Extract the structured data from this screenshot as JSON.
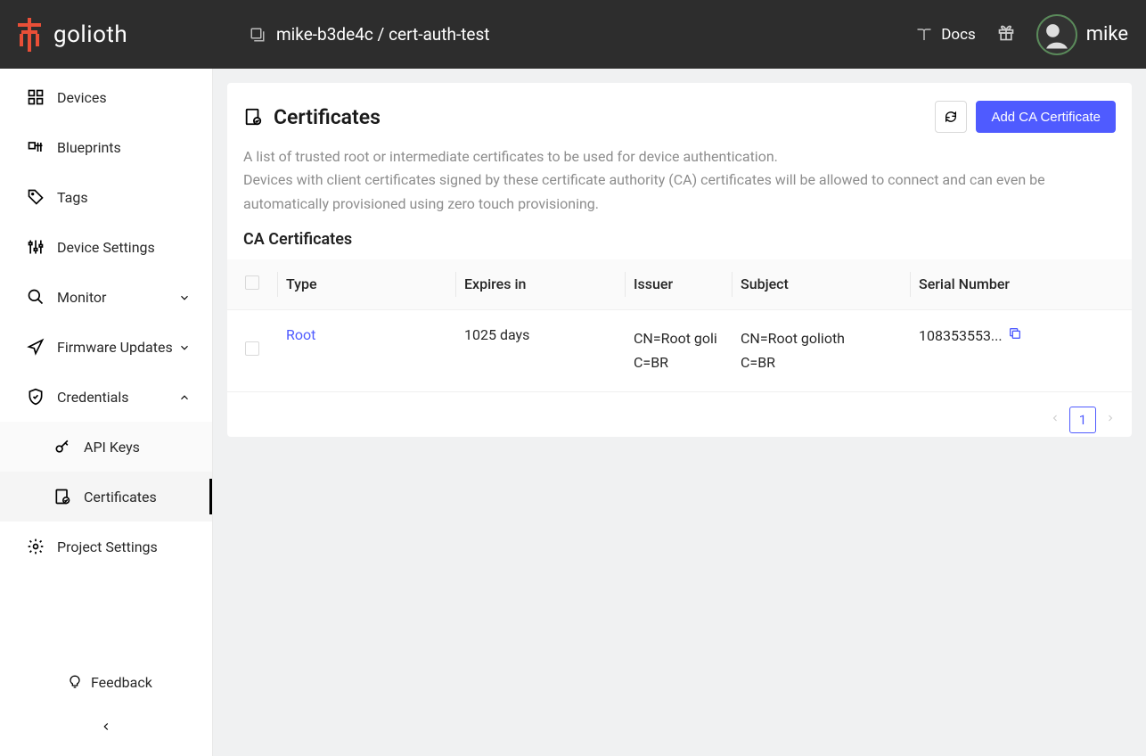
{
  "brand": {
    "name": "golioth"
  },
  "header": {
    "breadcrumb": "mike-b3de4c / cert-auth-test",
    "docs_label": "Docs",
    "username": "mike"
  },
  "sidebar": {
    "items": [
      {
        "label": "Devices",
        "icon": "grid"
      },
      {
        "label": "Blueprints",
        "icon": "blueprint"
      },
      {
        "label": "Tags",
        "icon": "tag"
      },
      {
        "label": "Device Settings",
        "icon": "sliders"
      },
      {
        "label": "Monitor",
        "icon": "search",
        "expandable": true,
        "expanded": false
      },
      {
        "label": "Firmware Updates",
        "icon": "send",
        "expandable": true,
        "expanded": false
      },
      {
        "label": "Credentials",
        "icon": "shield",
        "expandable": true,
        "expanded": true,
        "children": [
          {
            "label": "API Keys",
            "icon": "key",
            "active": false
          },
          {
            "label": "Certificates",
            "icon": "certificate",
            "active": true
          }
        ]
      },
      {
        "label": "Project Settings",
        "icon": "gear"
      }
    ],
    "feedback_label": "Feedback"
  },
  "page": {
    "title": "Certificates",
    "add_button": "Add CA Certificate",
    "description_line1": "A list of trusted root or intermediate certificates to be used for device authentication.",
    "description_line2": "Devices with client certificates signed by these certificate authority (CA) certificates will be allowed to connect and can even be automatically provisioned using zero touch provisioning.",
    "subheading": "CA Certificates"
  },
  "table": {
    "columns": {
      "type": "Type",
      "expires": "Expires in",
      "issuer": "Issuer",
      "subject": "Subject",
      "serial": "Serial Number"
    },
    "rows": [
      {
        "type": "Root",
        "expires": "1025 days",
        "issuer_line1": "CN=Root goli",
        "issuer_line2": "C=BR",
        "subject_line1": "CN=Root golioth",
        "subject_line2": "C=BR",
        "serial": "108353553..."
      }
    ]
  },
  "pagination": {
    "current": "1"
  }
}
